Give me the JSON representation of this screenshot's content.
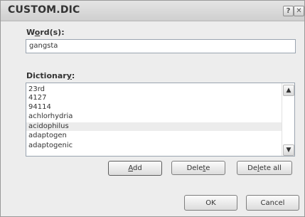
{
  "window": {
    "title": "CUSTOM.DIC",
    "help_glyph": "?",
    "close_glyph": "✕"
  },
  "words": {
    "label_pre": "W",
    "label_mnemonic": "o",
    "label_post": "rd(s):",
    "value": "gangsta"
  },
  "dictionary": {
    "label_pre": "Dictionar",
    "label_mnemonic": "y",
    "label_post": ":",
    "items": [
      "23rd",
      "4127",
      "94114",
      "achlorhydria",
      "acidophilus",
      "adaptogen",
      "adaptogenic"
    ],
    "selected_index": 4
  },
  "buttons": {
    "add_mnemonic": "A",
    "add_post": "dd",
    "delete_pre": "Dele",
    "delete_mnemonic": "t",
    "delete_post": "e",
    "deleteall_pre": "De",
    "deleteall_mnemonic": "l",
    "deleteall_post": "ete all",
    "ok": "OK",
    "cancel": "Cancel"
  },
  "icons": {
    "help": "help-icon",
    "close": "close-icon",
    "scroll_up": "scroll-up-arrow-icon",
    "scroll_down": "scroll-down-arrow-icon"
  }
}
